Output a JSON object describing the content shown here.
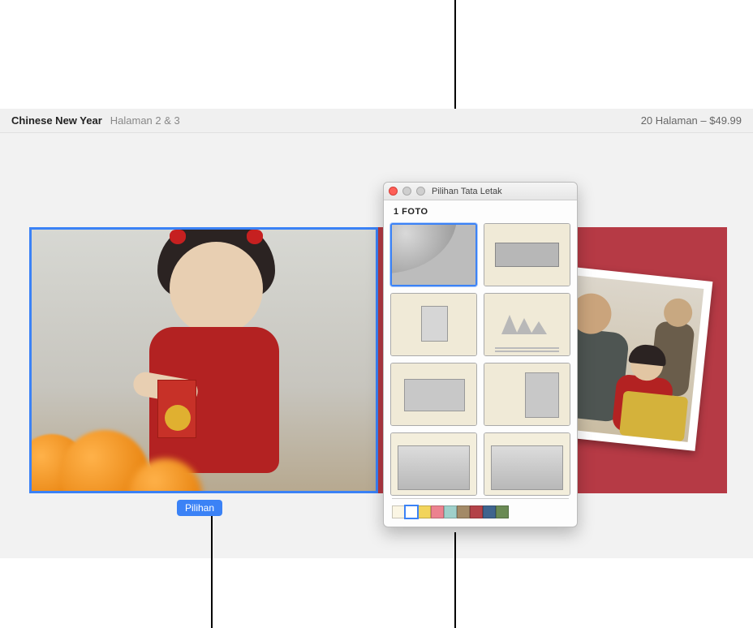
{
  "header": {
    "title": "Chinese New Year",
    "page_label": "Halaman 2 & 3",
    "right_label": "20 Halaman – $49.99"
  },
  "left_page": {
    "options_button_label": "Pilihan"
  },
  "popup": {
    "window_title": "Pilihan Tata Letak",
    "section_label": "1 FOTO",
    "layouts": [
      {
        "name": "full-bleed",
        "selected": true
      },
      {
        "name": "panorama",
        "selected": false
      },
      {
        "name": "small-center",
        "selected": false
      },
      {
        "name": "opera-caption",
        "selected": false
      },
      {
        "name": "horse-wide",
        "selected": false
      },
      {
        "name": "portrait-right",
        "selected": false
      },
      {
        "name": "bridge-left",
        "selected": false
      },
      {
        "name": "bridge-right",
        "selected": false
      }
    ],
    "colors": [
      {
        "hex": "#fbf6e4",
        "selected": false
      },
      {
        "hex": "#ffffff",
        "selected": true
      },
      {
        "hex": "#f2d45b",
        "selected": false
      },
      {
        "hex": "#ec828f",
        "selected": false
      },
      {
        "hex": "#9fd0ca",
        "selected": false
      },
      {
        "hex": "#a38a67",
        "selected": false
      },
      {
        "hex": "#b34248",
        "selected": false
      },
      {
        "hex": "#3f648e",
        "selected": false
      },
      {
        "hex": "#6a8a54",
        "selected": false
      }
    ]
  }
}
